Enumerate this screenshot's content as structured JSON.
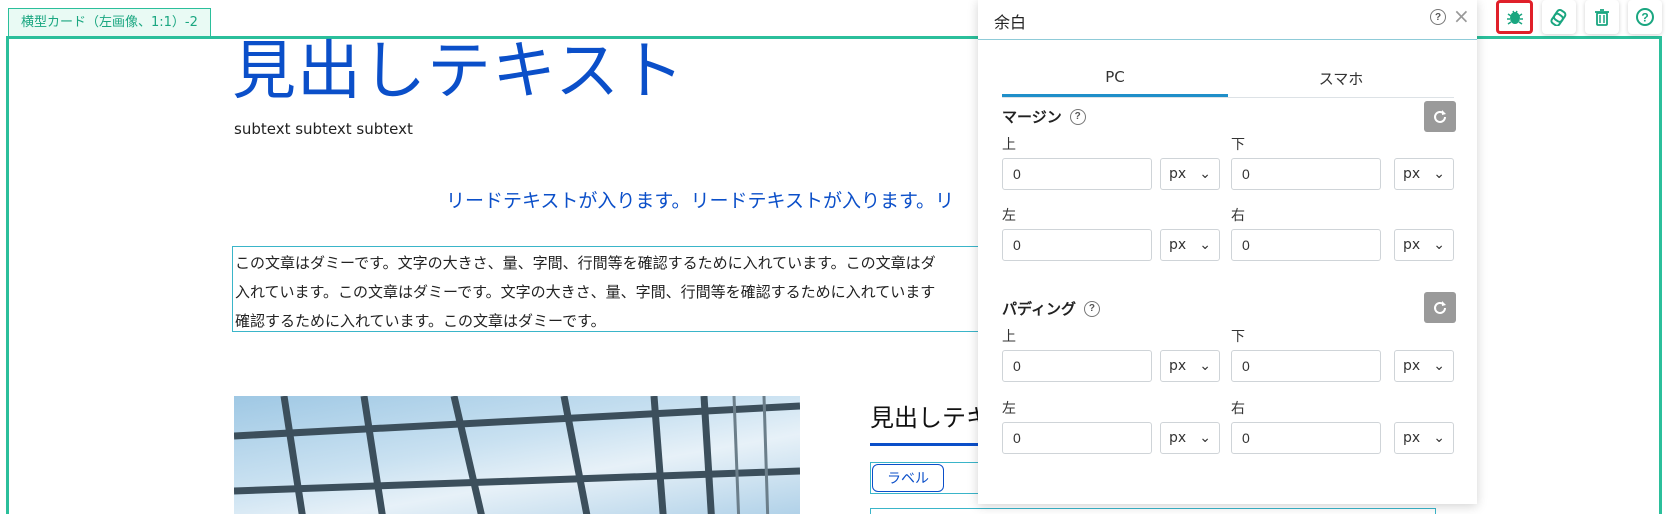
{
  "block": {
    "tab_label": "横型カード（左画像、1:1）-2"
  },
  "toolbar": {
    "icons": [
      "bug-icon",
      "copy-icon",
      "trash-icon",
      "help-icon"
    ],
    "accent_color": "#1aa680",
    "active_border_color": "#e0202a"
  },
  "content": {
    "heading": "見出しテキスト",
    "subtext": "subtext subtext subtext",
    "lead": "リードテキストが入ります。リードテキストが入ります。リ",
    "body_lines": [
      "この文章はダミーです。文字の大きさ、量、字間、行間等を確認するために入れています。この文章はダ",
      "入れています。この文章はダミーです。文字の大きさ、量、字間、行間等を確認するために入れています",
      "確認するために入れています。この文章はダミーです。"
    ],
    "card_heading": "見出しテキ",
    "card_label": "ラベル"
  },
  "panel": {
    "title": "余白",
    "help_glyph": "?",
    "close_glyph": "×",
    "tabs": [
      {
        "label": "PC",
        "active": true
      },
      {
        "label": "スマホ",
        "active": false
      }
    ],
    "margin": {
      "title": "マージン",
      "top_label": "上",
      "bottom_label": "下",
      "left_label": "左",
      "right_label": "右",
      "top_value": "0",
      "bottom_value": "0",
      "left_value": "0",
      "right_value": "0",
      "unit": "px"
    },
    "padding": {
      "title": "パディング",
      "top_label": "上",
      "bottom_label": "下",
      "left_label": "左",
      "right_label": "右",
      "top_value": "0",
      "bottom_value": "0",
      "left_value": "0",
      "right_value": "0",
      "unit": "px"
    }
  }
}
